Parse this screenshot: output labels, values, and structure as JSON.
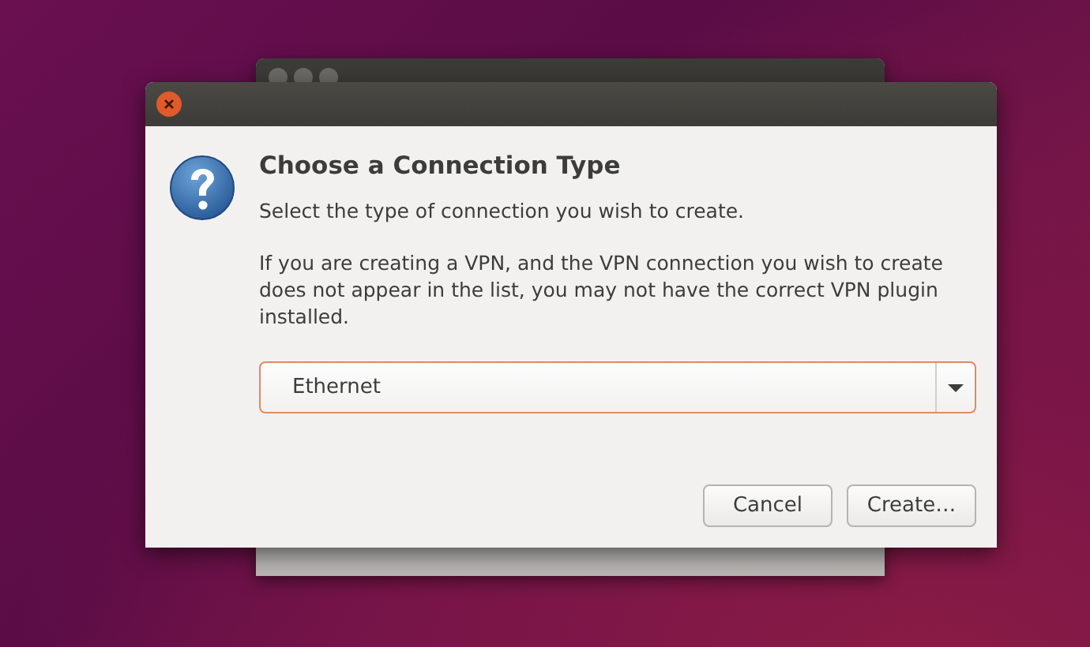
{
  "background_window": {
    "kind": "window"
  },
  "dialog": {
    "heading": "Choose a Connection Type",
    "prompt": "Select the type of connection you wish to create.",
    "note": "If you are creating a VPN, and the VPN connection you wish to create does not appear in the list, you may not have the correct VPN plugin installed.",
    "connection_type": {
      "value": "Ethernet"
    },
    "buttons": [
      "Cancel",
      "Create…"
    ]
  }
}
